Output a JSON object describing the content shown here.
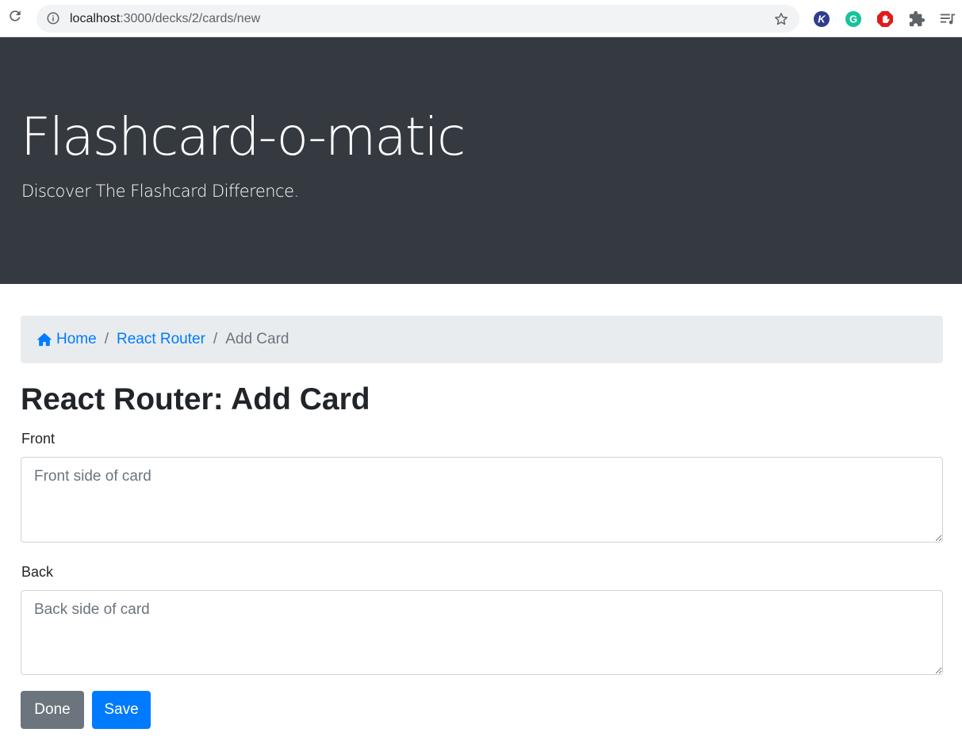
{
  "browser": {
    "url_host": "localhost",
    "url_path": ":3000/decks/2/cards/new",
    "icons": {
      "reload": "reload-icon",
      "info": "info-icon",
      "bookmark": "star-icon",
      "extensions": [
        "k-extension-icon",
        "grammarly-icon",
        "adblock-icon",
        "puzzle-icon",
        "media-queue-icon"
      ]
    },
    "extension_letters": {
      "k": "K",
      "grammarly": "G"
    }
  },
  "header": {
    "title": "Flashcard-o-matic",
    "subtitle": "Discover The Flashcard Difference."
  },
  "breadcrumb": {
    "items": [
      {
        "label": "Home",
        "icon": "home-icon",
        "link": true
      },
      {
        "label": "React Router",
        "link": true
      },
      {
        "label": "Add Card",
        "link": false
      }
    ],
    "separator": "/"
  },
  "main": {
    "title": "React Router: Add Card",
    "front": {
      "label": "Front",
      "placeholder": "Front side of card",
      "value": ""
    },
    "back": {
      "label": "Back",
      "placeholder": "Back side of card",
      "value": ""
    },
    "buttons": {
      "done": "Done",
      "save": "Save"
    }
  },
  "colors": {
    "header_bg": "#343a40",
    "link": "#007bff",
    "secondary": "#6c757d",
    "breadcrumb_bg": "#e9ecef",
    "primary_button": "#007bff"
  }
}
